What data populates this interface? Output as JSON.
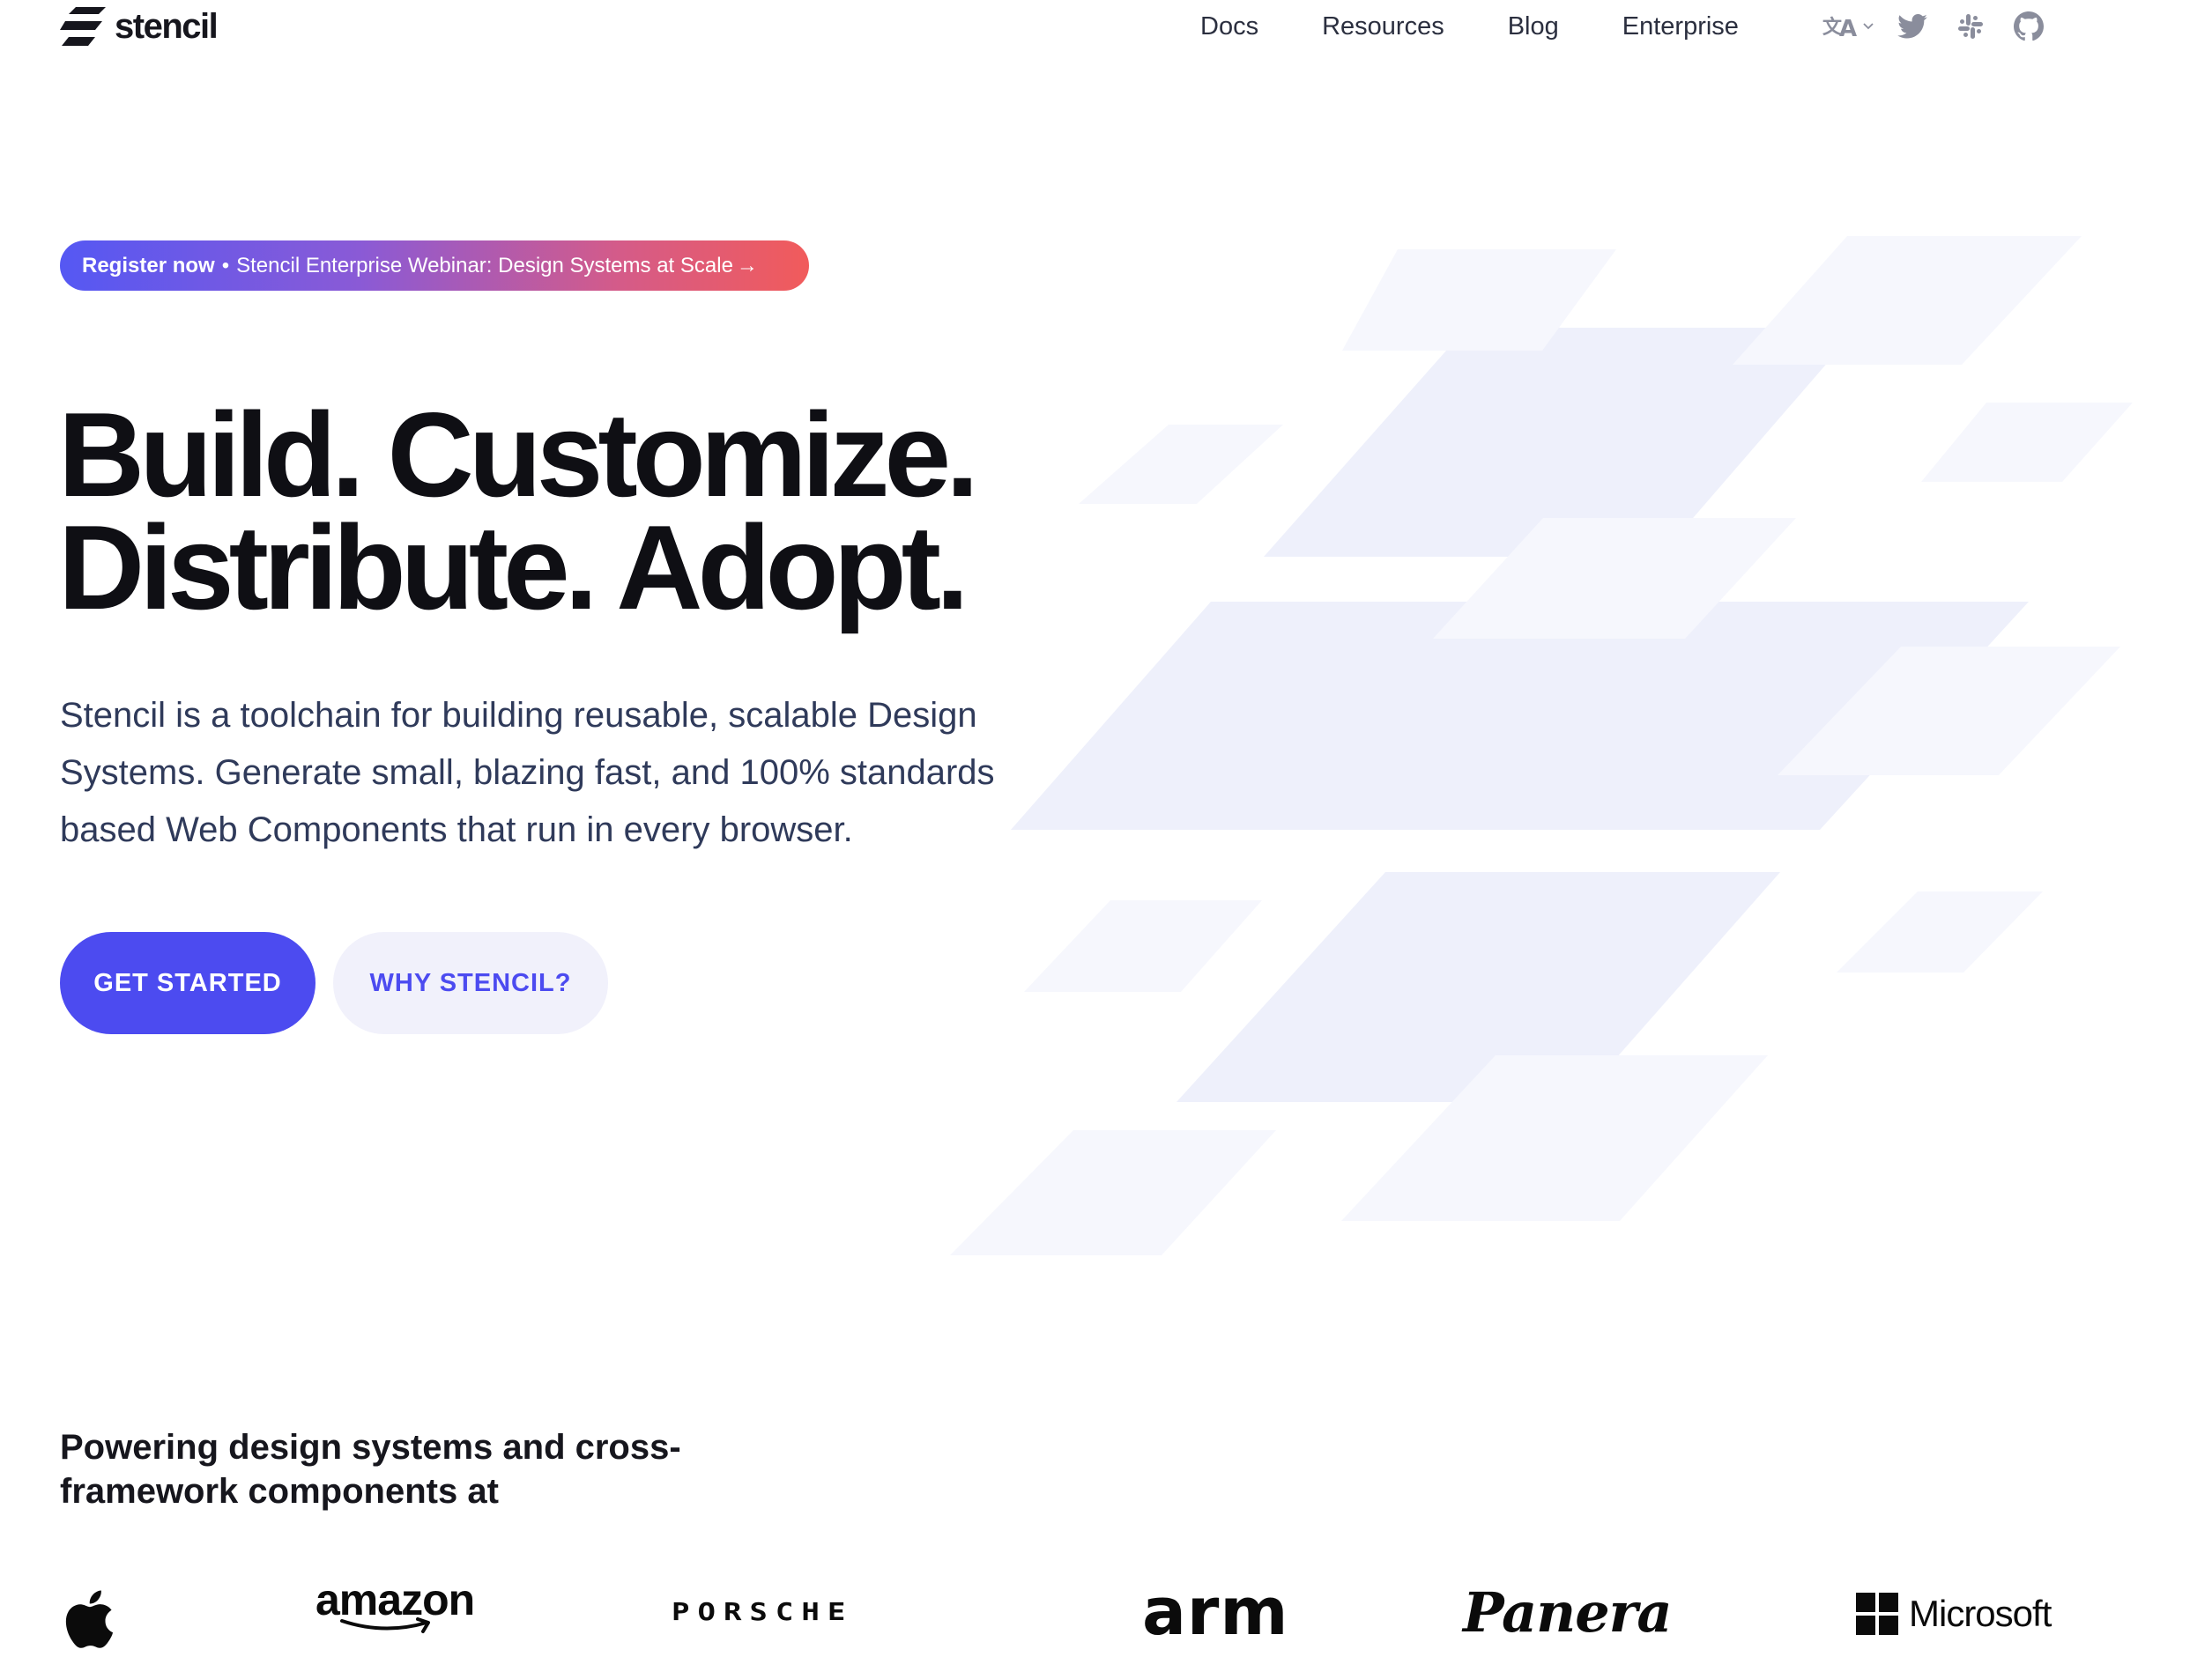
{
  "header": {
    "logo_text": "stencil",
    "nav": [
      {
        "label": "Docs"
      },
      {
        "label": "Resources"
      },
      {
        "label": "Blog"
      },
      {
        "label": "Enterprise"
      }
    ],
    "icons": [
      "translate-icon",
      "twitter-icon",
      "slack-icon",
      "github-icon"
    ]
  },
  "hero": {
    "banner": {
      "strong": "Register now",
      "separator": "•",
      "text": "Stencil Enterprise Webinar: Design Systems at Scale",
      "arrow": "→"
    },
    "headline_line1": "Build. Customize.",
    "headline_line2": "Distribute. Adopt.",
    "description": "Stencil is a toolchain for building reusable, scalable Design Systems. Generate small, blazing fast, and 100% standards based Web Components that run in every browser.",
    "primary_button": "GET STARTED",
    "secondary_button": "WHY STENCIL?"
  },
  "logos_section": {
    "title": "Powering design systems and cross-framework components at",
    "brands": {
      "amazon": "amazon",
      "porsche": "PORSCHE",
      "arm": "arm",
      "panera": "Panera",
      "microsoft": "Microsoft"
    }
  },
  "colors": {
    "accent": "#4c4bf0",
    "secondary_button_bg": "#f1f1fb",
    "banner_gradient_start": "#5558f3",
    "banner_gradient_end": "#f15b5b",
    "body_text": "#2f3a5a",
    "headline": "#0f0f14"
  }
}
